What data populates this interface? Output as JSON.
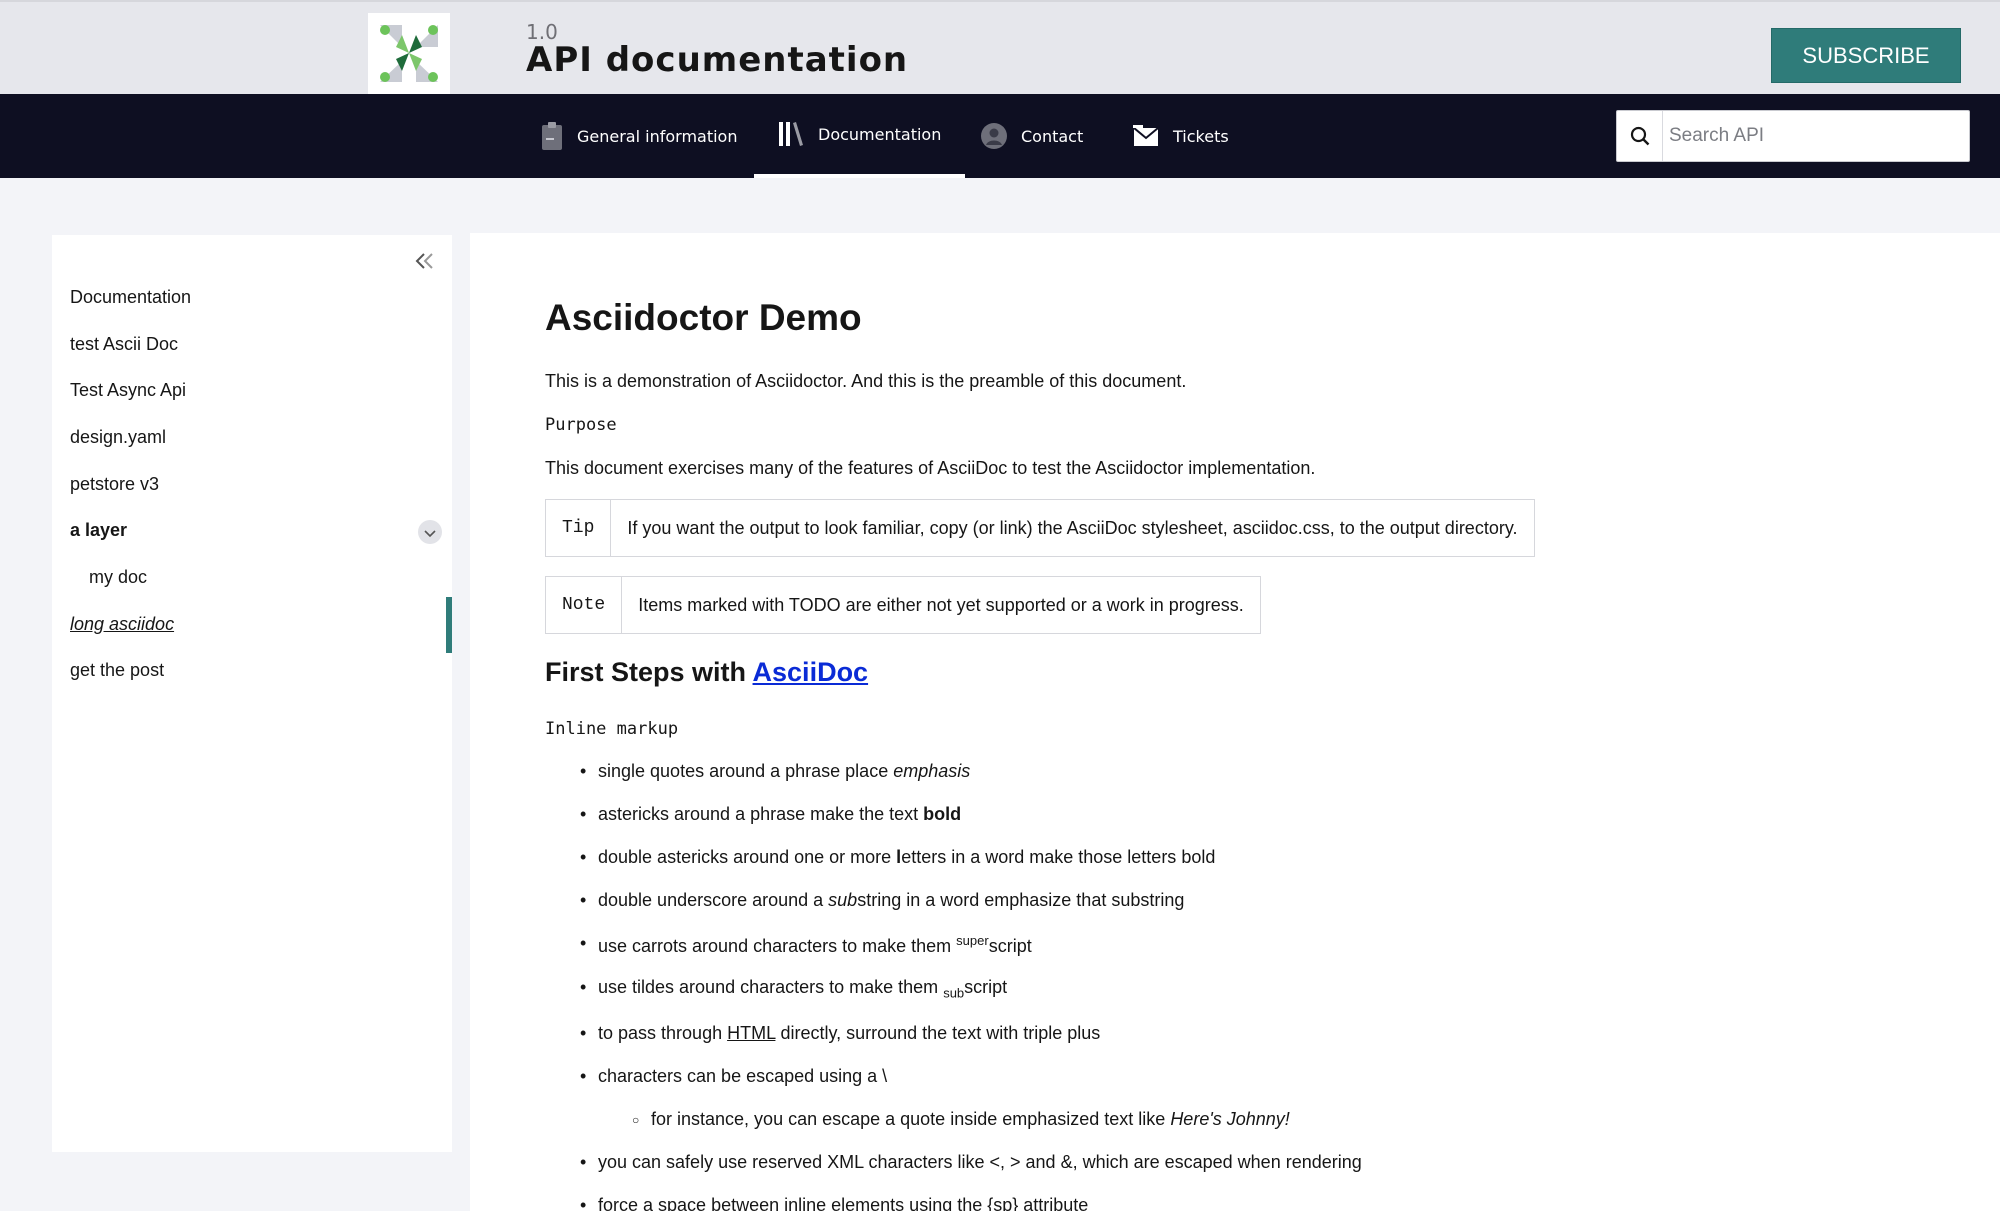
{
  "header": {
    "version": "1.0",
    "title": "API documentation",
    "subscribe_label": "SUBSCRIBE"
  },
  "nav": {
    "items": [
      {
        "label": "General information",
        "icon": "clipboard-icon"
      },
      {
        "label": "Documentation",
        "icon": "books-icon",
        "active": true
      },
      {
        "label": "Contact",
        "icon": "person-icon"
      },
      {
        "label": "Tickets",
        "icon": "envelope-icon"
      }
    ],
    "search_placeholder": "Search API"
  },
  "sidebar": {
    "items": [
      {
        "label": "Documentation"
      },
      {
        "label": "test Ascii Doc"
      },
      {
        "label": "Test Async Api"
      },
      {
        "label": "design.yaml"
      },
      {
        "label": "petstore v3"
      },
      {
        "label": "a layer",
        "expanded": true
      },
      {
        "label": "my doc"
      },
      {
        "label": "long asciidoc",
        "active": true
      },
      {
        "label": "get the post"
      }
    ]
  },
  "content": {
    "title": "Asciidoctor Demo",
    "preamble": "This is a demonstration of Asciidoctor. And this is the preamble of this document.",
    "purpose_label": "Purpose",
    "purpose_text": "This document exercises many of the features of AsciiDoc to test the Asciidoctor implementation.",
    "tip": {
      "label": "Tip",
      "text": "If you want the output to look familiar, copy (or link) the AsciiDoc stylesheet, asciidoc.css, to the output directory."
    },
    "note": {
      "label": "Note",
      "text": "Items marked with TODO are either not yet supported or a work in progress."
    },
    "section_title": "First Steps with ",
    "section_link": "AsciiDoc",
    "inline_label": "Inline markup",
    "list": {
      "i1_a": "single quotes around a phrase place ",
      "i1_b": "emphasis",
      "i2_a": "astericks around a phrase make the text ",
      "i2_b": "bold",
      "i3_a": "double astericks around one or more ",
      "i3_b": "l",
      "i3_c": "etters in a word make those letters bold",
      "i4_a": "double underscore around a ",
      "i4_b": "sub",
      "i4_c": "string in a word emphasize that substring",
      "i5_a": "use carrots around characters to make them ",
      "i5_b": "super",
      "i5_c": "script",
      "i6_a": "use tildes around characters to make them ",
      "i6_b": "sub",
      "i6_c": "script",
      "i7_a": "to pass through ",
      "i7_b": "HTML",
      "i7_c": " directly, surround the text with triple plus",
      "i8": "characters can be escaped using a \\",
      "i9_a": "for instance, you can escape a quote inside emphasized text like ",
      "i9_b": "Here's Johnny!",
      "i10": "you can safely use reserved XML characters like <, > and &, which are escaped when rendering",
      "i11": "force a space between inline elements using the {sp} attribute"
    }
  }
}
